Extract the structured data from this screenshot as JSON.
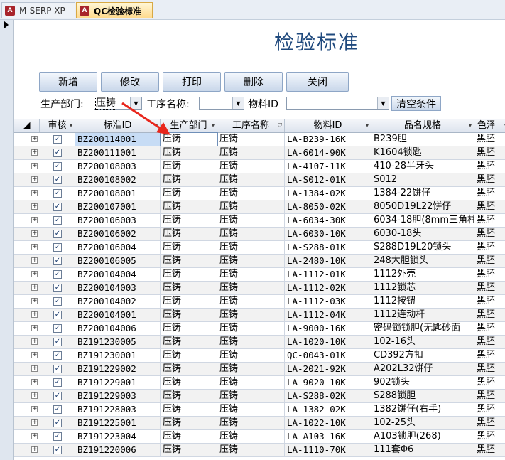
{
  "tabs": [
    {
      "label": "M-SERP XP"
    },
    {
      "label": "QC检验标准"
    }
  ],
  "form_title": "检验标准",
  "buttons": {
    "add": "新增",
    "edit": "修改",
    "print": "打印",
    "delete": "删除",
    "close": "关闭"
  },
  "filters": {
    "dept_label": "生产部门:",
    "dept_value": "压铸",
    "process_label": "工序名称:",
    "process_value": "",
    "material_label": "物料ID",
    "material_value": "",
    "clear_label": "清空条件"
  },
  "grid": {
    "columns": [
      "审核",
      "标准ID",
      "生产部门",
      "工序名称",
      "物料ID",
      "品名规格",
      "色泽"
    ],
    "rows": [
      {
        "id": "BZ200114001",
        "dept": "压铸",
        "process": "压铸",
        "material": "LA-B239-16K",
        "spec": "B239胆",
        "color": "黑胚"
      },
      {
        "id": "BZ200111001",
        "dept": "压铸",
        "process": "压铸",
        "material": "LA-6014-90K",
        "spec": "K1604锁匙",
        "color": "黑胚"
      },
      {
        "id": "BZ200108003",
        "dept": "压铸",
        "process": "压铸",
        "material": "LA-4107-11K",
        "spec": "410-28半牙头",
        "color": "黑胚"
      },
      {
        "id": "BZ200108002",
        "dept": "压铸",
        "process": "压铸",
        "material": "LA-S012-01K",
        "spec": "S012",
        "color": "黑胚"
      },
      {
        "id": "BZ200108001",
        "dept": "压铸",
        "process": "压铸",
        "material": "LA-1384-02K",
        "spec": "1384-22饼仔",
        "color": "黑胚"
      },
      {
        "id": "BZ200107001",
        "dept": "压铸",
        "process": "压铸",
        "material": "LA-8050-02K",
        "spec": "8050D19L22饼仔",
        "color": "黑胚"
      },
      {
        "id": "BZ200106003",
        "dept": "压铸",
        "process": "压铸",
        "material": "LA-6034-30K",
        "spec": "6034-18胆(8mm三角柱",
        "color": "黑胚"
      },
      {
        "id": "BZ200106002",
        "dept": "压铸",
        "process": "压铸",
        "material": "LA-6030-10K",
        "spec": "6030-18头",
        "color": "黑胚"
      },
      {
        "id": "BZ200106004",
        "dept": "压铸",
        "process": "压铸",
        "material": "LA-S288-01K",
        "spec": "S288D19L20锁头",
        "color": "黑胚"
      },
      {
        "id": "BZ200106005",
        "dept": "压铸",
        "process": "压铸",
        "material": "LA-2480-10K",
        "spec": "248大胆锁头",
        "color": "黑胚"
      },
      {
        "id": "BZ200104004",
        "dept": "压铸",
        "process": "压铸",
        "material": "LA-1112-01K",
        "spec": "1112外壳",
        "color": "黑胚"
      },
      {
        "id": "BZ200104003",
        "dept": "压铸",
        "process": "压铸",
        "material": "LA-1112-02K",
        "spec": "1112锁芯",
        "color": "黑胚"
      },
      {
        "id": "BZ200104002",
        "dept": "压铸",
        "process": "压铸",
        "material": "LA-1112-03K",
        "spec": "1112按钮",
        "color": "黑胚"
      },
      {
        "id": "BZ200104001",
        "dept": "压铸",
        "process": "压铸",
        "material": "LA-1112-04K",
        "spec": "1112连动杆",
        "color": "黑胚"
      },
      {
        "id": "BZ200104006",
        "dept": "压铸",
        "process": "压铸",
        "material": "LA-9000-16K",
        "spec": "密码锁锁胆(无匙砂面",
        "color": "黑胚"
      },
      {
        "id": "BZ191230005",
        "dept": "压铸",
        "process": "压铸",
        "material": "LA-1020-10K",
        "spec": "102-16头",
        "color": "黑胚"
      },
      {
        "id": "BZ191230001",
        "dept": "压铸",
        "process": "压铸",
        "material": "QC-0043-01K",
        "spec": "CD392方扣",
        "color": "黑胚"
      },
      {
        "id": "BZ191229002",
        "dept": "压铸",
        "process": "压铸",
        "material": "LA-2021-92K",
        "spec": "A202L32饼仔",
        "color": "黑胚"
      },
      {
        "id": "BZ191229001",
        "dept": "压铸",
        "process": "压铸",
        "material": "LA-9020-10K",
        "spec": "902锁头",
        "color": "黑胚"
      },
      {
        "id": "BZ191229003",
        "dept": "压铸",
        "process": "压铸",
        "material": "LA-S288-02K",
        "spec": "S288锁胆",
        "color": "黑胚"
      },
      {
        "id": "BZ191228003",
        "dept": "压铸",
        "process": "压铸",
        "material": "LA-1382-02K",
        "spec": "1382饼仔(右手)",
        "color": "黑胚"
      },
      {
        "id": "BZ191225001",
        "dept": "压铸",
        "process": "压铸",
        "material": "LA-1022-10K",
        "spec": "102-25头",
        "color": "黑胚"
      },
      {
        "id": "BZ191223004",
        "dept": "压铸",
        "process": "压铸",
        "material": "LA-A103-16K",
        "spec": "A103锁胆(268)",
        "color": "黑胚"
      },
      {
        "id": "BZ191220006",
        "dept": "压铸",
        "process": "压铸",
        "material": "LA-1110-70K",
        "spec": "111套Φ6",
        "color": "黑胚"
      }
    ]
  },
  "colors": {
    "title": "#1f497d",
    "annotation_arrow": "#e8261c",
    "selected_row": "#c7dcf5"
  }
}
